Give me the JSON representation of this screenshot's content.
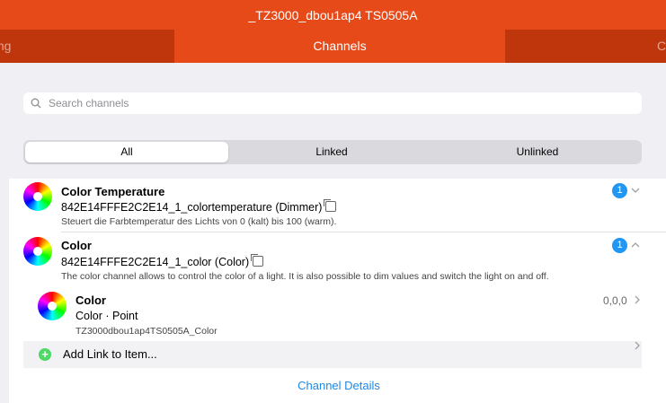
{
  "window": {
    "title": "_TZ3000_dbou1ap4 TS0505A"
  },
  "tabs": [
    {
      "label": "hing"
    },
    {
      "label": "Channels",
      "active": true
    },
    {
      "label": "C"
    }
  ],
  "search": {
    "placeholder": "Search channels",
    "value": ""
  },
  "filter": {
    "options": [
      "All",
      "Linked",
      "Unlinked"
    ],
    "selected": "All"
  },
  "channels": [
    {
      "title": "Color Temperature",
      "uid": "842E14FFFE2C2E14_1_colortemperature (Dimmer)",
      "description": "Steuert die Farbtemperatur des Lichts von 0 (kalt) bis 100 (warm).",
      "link_count": "1",
      "expanded": false
    },
    {
      "title": "Color",
      "uid": "842E14FFFE2C2E14_1_color (Color)",
      "description": "The color channel allows to control the color of a light. It is also possible to dim values and switch the light on and off.",
      "link_count": "1",
      "expanded": true,
      "item": {
        "label": "Color",
        "type": "Color · Point",
        "name": "TZ3000dbou1ap4TS0505A_Color",
        "state": "0,0,0"
      },
      "add_link_label": "Add Link to Item...",
      "details_label": "Channel Details"
    }
  ],
  "colors": {
    "header": "#e64a19",
    "tab_inactive": "#bf360c",
    "badge": "#2196f3",
    "link": "#1e88e5",
    "add": "#4cd964"
  }
}
